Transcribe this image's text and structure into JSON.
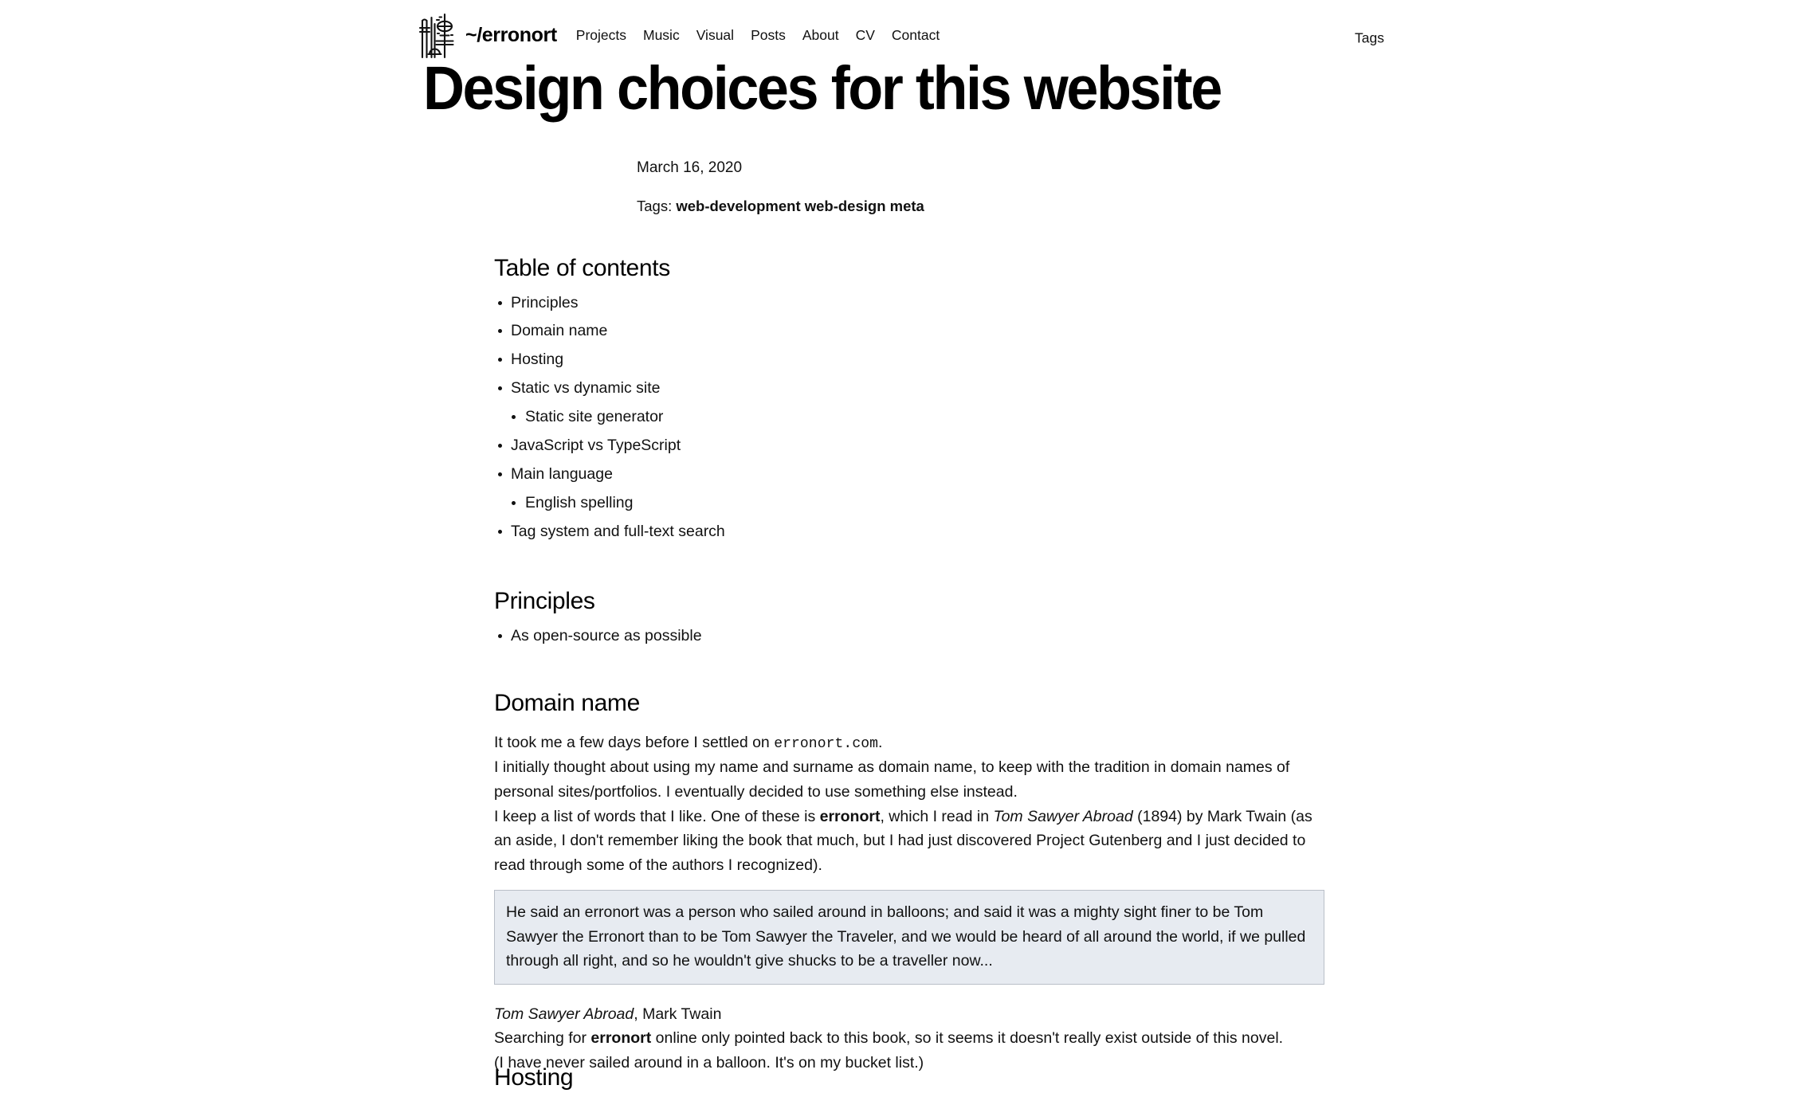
{
  "nav": {
    "logo_name": "radio-towers-logo",
    "brand": "~/erronort",
    "links": [
      {
        "label": "Projects"
      },
      {
        "label": "Music"
      },
      {
        "label": "Visual"
      },
      {
        "label": "Posts"
      },
      {
        "label": "About"
      },
      {
        "label": "CV"
      },
      {
        "label": "Contact"
      }
    ],
    "right_link": "Tags"
  },
  "post": {
    "title": "Design choices for this website",
    "date": "March 16, 2020",
    "tags_label": "Tags:",
    "tags": "web-development web-design meta"
  },
  "toc": {
    "heading": "Table of contents",
    "items": [
      {
        "label": "Principles",
        "level": 1
      },
      {
        "label": "Domain name",
        "level": 1
      },
      {
        "label": "Hosting",
        "level": 1
      },
      {
        "label": "Static vs dynamic site",
        "level": 1
      },
      {
        "label": "Static site generator",
        "level": 2
      },
      {
        "label": "JavaScript vs TypeScript",
        "level": 1
      },
      {
        "label": "Main language",
        "level": 1
      },
      {
        "label": "English spelling",
        "level": 2
      },
      {
        "label": "Tag system and full-text search",
        "level": 1
      }
    ]
  },
  "principles": {
    "heading": "Principles",
    "items": [
      {
        "label": "As open-source as possible"
      }
    ]
  },
  "domain": {
    "heading": "Domain name",
    "p1_before": "It took me a few days before I settled on ",
    "p1_code": "erronort.com",
    "p1_after": ".",
    "p2": "I initially thought about using my name and surname as domain name, to keep with the tradition in domain names of personal sites/portfolios. I eventually decided to use something else instead.",
    "p3_a": "I keep a list of words that I like. One of these is ",
    "p3_bold": "erronort",
    "p3_b": ", which I read in ",
    "p3_ital": "Tom Sawyer Abroad",
    "p3_c": " (1894) by Mark Twain (as an aside, I don't remember liking the book that much, but I had just discovered Project Gutenberg and I just decided to read through some of the authors I recognized).",
    "quote": "He said an erronort was a person who sailed around in balloons; and said it was a mighty sight finer to be Tom Sawyer the Erronort than to be Tom Sawyer the Traveler, and we would be heard of all around the world, if we pulled through all right, and so he wouldn't give shucks to be a traveller now...",
    "cite_ital": "Tom Sawyer Abroad",
    "cite_rest": ", Mark Twain",
    "p4_a": "Searching for ",
    "p4_bold": "erronort",
    "p4_b": " online only pointed back to this book, so it seems it doesn't really exist outside of this novel.",
    "p5": "(I have never sailed around in a balloon. It's on my bucket list.)"
  },
  "hosting": {
    "heading": "Hosting"
  },
  "colors": {
    "text": "#111111",
    "background": "#ffffff",
    "quote_background": "#e7ebf1",
    "quote_border": "#b9bfc8"
  }
}
